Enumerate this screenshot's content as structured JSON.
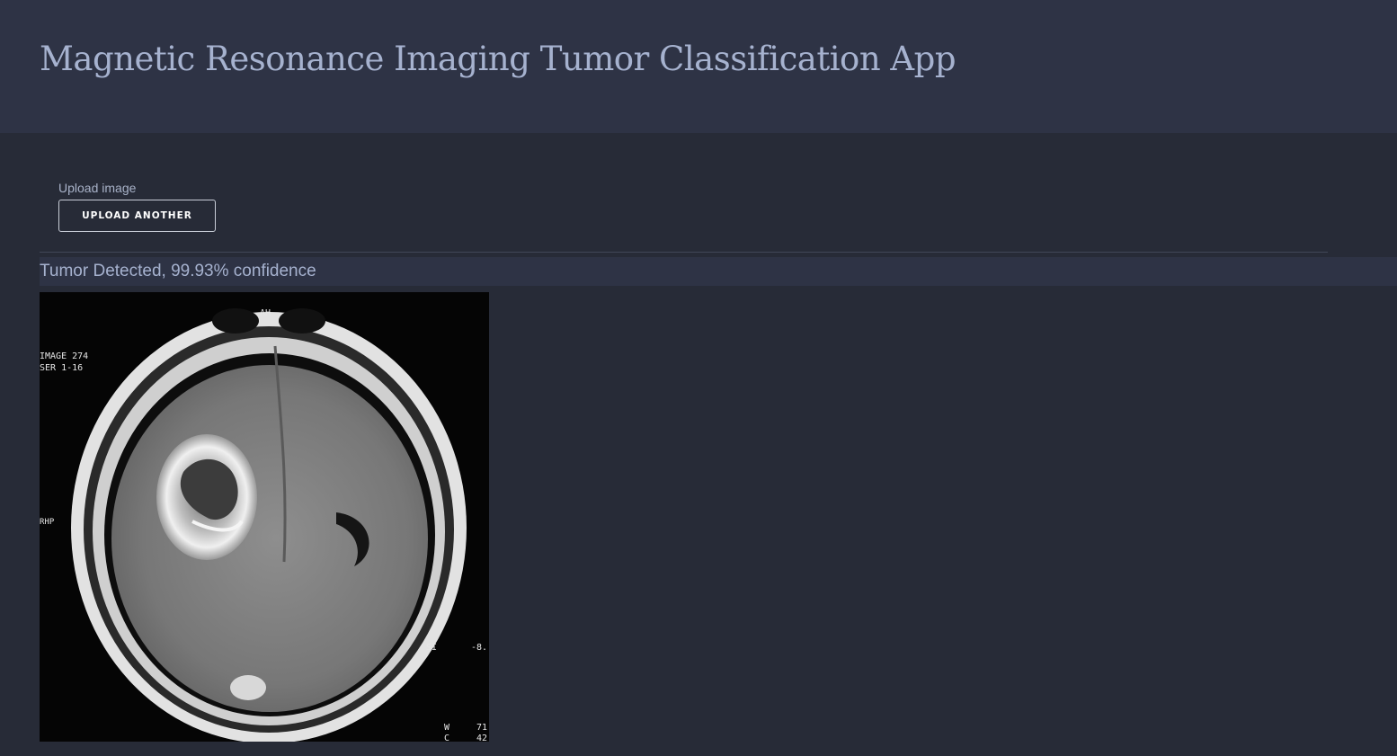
{
  "header": {
    "title": "Magnetic Resonance Imaging Tumor Classification App"
  },
  "upload": {
    "label": "Upload image",
    "button_label": "UPLOAD ANOTHER"
  },
  "result": {
    "text": "Tumor Detected, 99.93% confidence"
  },
  "scan_overlay": {
    "top_label": "AH",
    "image_line": "IMAGE 274",
    "series_line": "SER 1-16",
    "side_label": "RHP",
    "bottom_right_label": "SI",
    "offset_label": "-8.",
    "w_label": "W",
    "w_value": "71",
    "c_label": "C",
    "c_value": "42"
  },
  "colors": {
    "header_bg": "#2e3345",
    "page_bg": "#272b37",
    "title_text": "#a6b2cf",
    "result_banner_bg": "#2e3345"
  }
}
